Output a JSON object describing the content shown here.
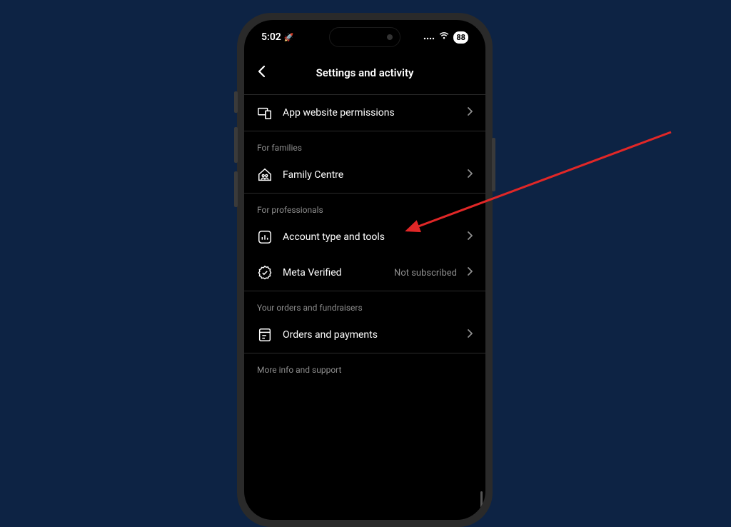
{
  "status_bar": {
    "time": "5:02",
    "battery": "88"
  },
  "header": {
    "title": "Settings and activity"
  },
  "rows": {
    "app_permissions": {
      "label": "App website permissions"
    },
    "family_centre": {
      "label": "Family Centre"
    },
    "account_type": {
      "label": "Account type and tools"
    },
    "meta_verified": {
      "label": "Meta Verified",
      "status": "Not subscribed"
    },
    "orders": {
      "label": "Orders and payments"
    }
  },
  "sections": {
    "families": "For families",
    "professionals": "For professionals",
    "orders": "Your orders and fundraisers",
    "more_info": "More info and support"
  }
}
